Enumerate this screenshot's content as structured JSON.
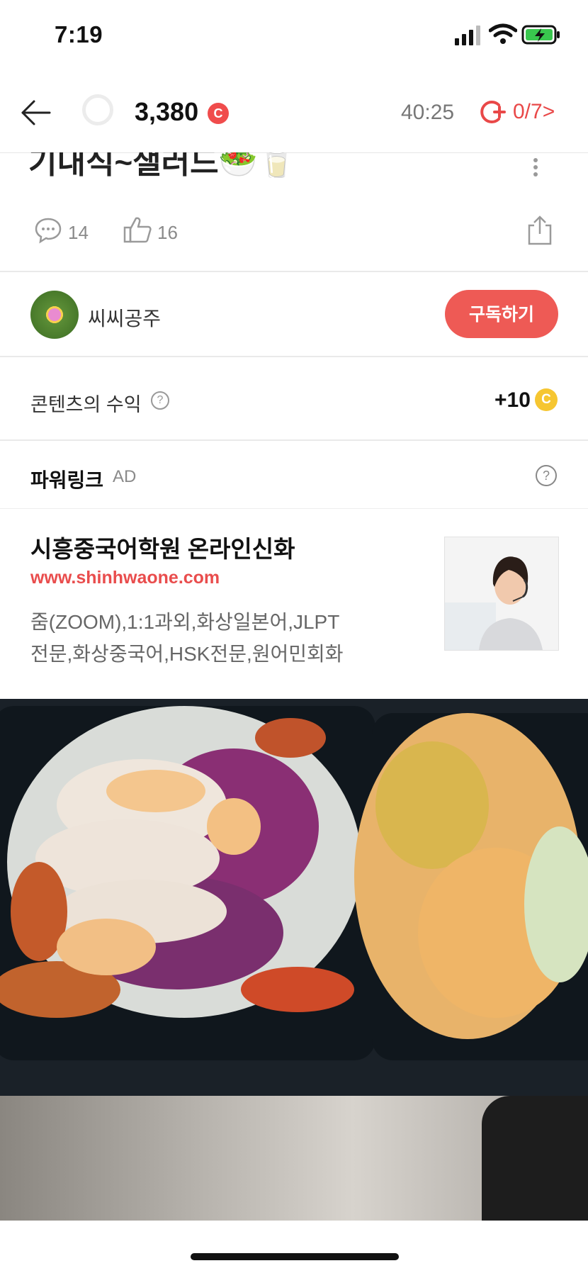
{
  "status_bar": {
    "time": "7:19"
  },
  "nav": {
    "points": "3,380",
    "points_coin": "C",
    "timer": "40:25",
    "progress": "0/7>"
  },
  "post": {
    "title": "기내식~샐러드🥗🥛",
    "comments": "14",
    "likes": "16"
  },
  "author": {
    "name": "씨씨공주",
    "subscribe_label": "구독하기"
  },
  "revenue": {
    "label": "콘텐츠의 수익",
    "help": "?",
    "value": "+10",
    "coin": "C"
  },
  "powerlink": {
    "title": "파워링크",
    "ad_tag": "AD",
    "help": "?",
    "ad": {
      "title": "시흥중국어학원 온라인신화",
      "url": "www.shinhwaone.com",
      "desc_line1": "줌(ZOOM),1:1과외,화상일본어,JLPT",
      "desc_line2": "전문,화상중국어,HSK전문,원어민회화"
    }
  },
  "colors": {
    "accent_red": "#ee5a55",
    "coin_gold": "#f6c631",
    "url_red": "#e94d4d"
  }
}
